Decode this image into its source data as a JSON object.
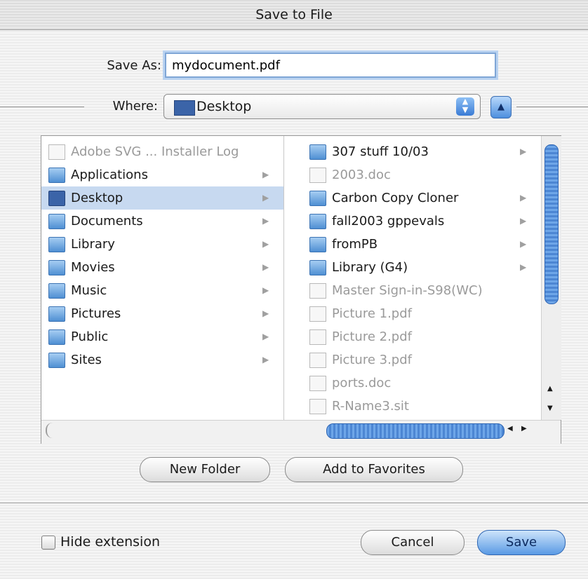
{
  "window": {
    "title": "Save to File"
  },
  "save_as": {
    "label": "Save As:",
    "value": "mydocument.pdf"
  },
  "where": {
    "label": "Where:",
    "selected": "Desktop"
  },
  "column1": [
    {
      "name": "Adobe SVG ... Installer Log",
      "type": "doc",
      "dim": true,
      "arrow": false
    },
    {
      "name": "Applications",
      "type": "folder",
      "dim": false,
      "arrow": true
    },
    {
      "name": "Desktop",
      "type": "desktop",
      "dim": false,
      "arrow": true,
      "selected": true
    },
    {
      "name": "Documents",
      "type": "folder",
      "dim": false,
      "arrow": true
    },
    {
      "name": "Library",
      "type": "folder",
      "dim": false,
      "arrow": true
    },
    {
      "name": "Movies",
      "type": "folder",
      "dim": false,
      "arrow": true
    },
    {
      "name": "Music",
      "type": "folder",
      "dim": false,
      "arrow": true
    },
    {
      "name": "Pictures",
      "type": "folder",
      "dim": false,
      "arrow": true
    },
    {
      "name": "Public",
      "type": "folder",
      "dim": false,
      "arrow": true
    },
    {
      "name": "Sites",
      "type": "folder",
      "dim": false,
      "arrow": true
    }
  ],
  "column2": [
    {
      "name": "307 stuff 10/03",
      "type": "folder",
      "dim": false,
      "arrow": true
    },
    {
      "name": "2003.doc",
      "type": "doc",
      "dim": true,
      "arrow": false
    },
    {
      "name": "Carbon Copy Cloner",
      "type": "folder",
      "dim": false,
      "arrow": true
    },
    {
      "name": "fall2003 gppevals",
      "type": "folder",
      "dim": false,
      "arrow": true
    },
    {
      "name": "fromPB",
      "type": "folder",
      "dim": false,
      "arrow": true
    },
    {
      "name": "Library (G4)",
      "type": "folder",
      "dim": false,
      "arrow": true
    },
    {
      "name": "Master Sign-in-S98(WC)",
      "type": "doc",
      "dim": true,
      "arrow": false
    },
    {
      "name": "Picture 1.pdf",
      "type": "doc",
      "dim": true,
      "arrow": false
    },
    {
      "name": "Picture 2.pdf",
      "type": "doc",
      "dim": true,
      "arrow": false
    },
    {
      "name": "Picture 3.pdf",
      "type": "doc",
      "dim": true,
      "arrow": false
    },
    {
      "name": "ports.doc",
      "type": "doc",
      "dim": true,
      "arrow": false
    },
    {
      "name": "R-Name3.sit",
      "type": "doc",
      "dim": true,
      "arrow": false
    }
  ],
  "buttons": {
    "new_folder": "New Folder",
    "add_favorites": "Add to Favorites",
    "cancel": "Cancel",
    "save": "Save"
  },
  "hide_extension": {
    "label": "Hide extension",
    "checked": false
  },
  "colors": {
    "accent": "#4c86d3",
    "selection": "#c7d9f0"
  }
}
